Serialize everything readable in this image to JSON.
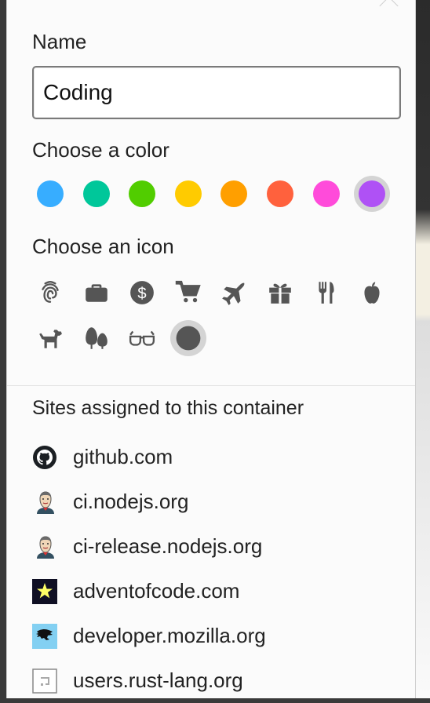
{
  "form": {
    "name_label": "Name",
    "name_value": "Coding",
    "color_label": "Choose a color",
    "icon_label": "Choose an icon",
    "sites_label": "Sites assigned to this container"
  },
  "colors": [
    {
      "name": "blue",
      "hex": "#37adff",
      "selected": false
    },
    {
      "name": "turquoise",
      "hex": "#00c79a",
      "selected": false
    },
    {
      "name": "green",
      "hex": "#51cd00",
      "selected": false
    },
    {
      "name": "yellow",
      "hex": "#ffcb00",
      "selected": false
    },
    {
      "name": "orange",
      "hex": "#ff9f00",
      "selected": false
    },
    {
      "name": "red",
      "hex": "#ff613d",
      "selected": false
    },
    {
      "name": "pink",
      "hex": "#ff4bda",
      "selected": false
    },
    {
      "name": "purple",
      "hex": "#af51f5",
      "selected": true
    }
  ],
  "icons": [
    {
      "name": "fingerprint-icon",
      "selected": false
    },
    {
      "name": "briefcase-icon",
      "selected": false
    },
    {
      "name": "dollar-icon",
      "selected": false
    },
    {
      "name": "cart-icon",
      "selected": false
    },
    {
      "name": "plane-icon",
      "selected": false
    },
    {
      "name": "gift-icon",
      "selected": false
    },
    {
      "name": "food-icon",
      "selected": false
    },
    {
      "name": "fruit-icon",
      "selected": false
    },
    {
      "name": "pet-icon",
      "selected": false
    },
    {
      "name": "tree-icon",
      "selected": false
    },
    {
      "name": "glasses-icon",
      "selected": false
    },
    {
      "name": "circle-icon",
      "selected": true
    }
  ],
  "icon_color": "#555555",
  "sites": [
    {
      "label": "github.com",
      "favicon": "github-icon"
    },
    {
      "label": "ci.nodejs.org",
      "favicon": "jenkins-icon"
    },
    {
      "label": "ci-release.nodejs.org",
      "favicon": "jenkins-icon"
    },
    {
      "label": "adventofcode.com",
      "favicon": "star-icon"
    },
    {
      "label": "developer.mozilla.org",
      "favicon": "mdn-dino-icon"
    },
    {
      "label": "users.rust-lang.org",
      "favicon": "rust-forum-icon"
    }
  ]
}
